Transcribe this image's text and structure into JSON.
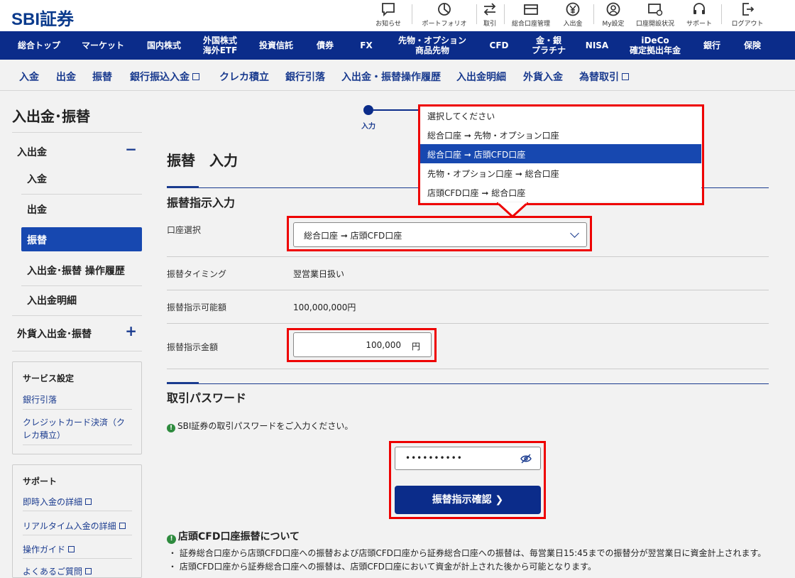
{
  "brand": {
    "logo": "SBI証券"
  },
  "utility": [
    {
      "label": "お知らせ",
      "icon": "message-icon"
    },
    {
      "label": "ポートフォリオ",
      "icon": "pie-chart-icon"
    },
    {
      "label": "取引",
      "icon": "arrows-icon"
    },
    {
      "label": "総合口座管理",
      "icon": "card-icon"
    },
    {
      "label": "入出金",
      "icon": "yen-icon"
    },
    {
      "label": "My設定",
      "icon": "user-icon"
    },
    {
      "label": "口座開設状況",
      "icon": "account-status-icon"
    },
    {
      "label": "サポート",
      "icon": "headset-icon"
    },
    {
      "label": "ログアウト",
      "icon": "logout-icon"
    }
  ],
  "global_nav": [
    {
      "label": "総合トップ"
    },
    {
      "label": "マーケット"
    },
    {
      "label": "国内株式"
    },
    {
      "label": "外国株式\n海外ETF"
    },
    {
      "label": "投資信託"
    },
    {
      "label": "債券"
    },
    {
      "label": "FX"
    },
    {
      "label": "先物・オプション\n商品先物"
    },
    {
      "label": "CFD"
    },
    {
      "label": "金・銀\nプラチナ"
    },
    {
      "label": "NISA"
    },
    {
      "label": "iDeCo\n確定拠出年金"
    },
    {
      "label": "銀行"
    },
    {
      "label": "保険"
    }
  ],
  "sub_nav": [
    {
      "label": "入金"
    },
    {
      "label": "出金"
    },
    {
      "label": "振替"
    },
    {
      "label": "銀行振込入金"
    },
    {
      "label": "クレカ積立"
    },
    {
      "label": "銀行引落"
    },
    {
      "label": "入出金・振替操作履歴"
    },
    {
      "label": "入出金明細"
    },
    {
      "label": "外貨入金"
    },
    {
      "label": "為替取引"
    }
  ],
  "sidebar": {
    "title": "入出金･振替",
    "group1": "入出金",
    "group1_toggle": "−",
    "items": [
      "入金",
      "出金",
      "振替",
      "入出金･振替 操作履歴",
      "入出金明細"
    ],
    "group2": "外貨入出金･振替",
    "group2_toggle": "+",
    "service": {
      "title": "サービス設定",
      "links": [
        "銀行引落",
        "クレジットカード決済（ク\nレカ積立）"
      ]
    },
    "support": {
      "title": "サポート",
      "links": [
        "即時入金の詳細",
        "リアルタイム入金の詳細",
        "操作ガイド",
        "よくあるご質問"
      ]
    }
  },
  "stepper": {
    "current": "入力"
  },
  "page": {
    "title": "振替　入力"
  },
  "transfer": {
    "section_title": "振替指示入力",
    "account_label": "口座選択",
    "account_value": "総合口座 ➞ 店頭CFD口座",
    "dropdown": [
      {
        "label": "選択してください",
        "selected": false
      },
      {
        "label": "総合口座 ➞ 先物・オプション口座",
        "selected": false
      },
      {
        "label": "総合口座 ➞ 店頭CFD口座",
        "selected": true
      },
      {
        "label": "先物・オプション口座 ➞ 総合口座",
        "selected": false
      },
      {
        "label": "店頭CFD口座 ➞ 総合口座",
        "selected": false
      }
    ],
    "timing_label": "振替タイミング",
    "timing_value": "翌営業日扱い",
    "available_label": "振替指示可能額",
    "available_value": "100,000,000円",
    "amount_label": "振替指示金額",
    "amount_value": "100,000",
    "amount_unit": "円"
  },
  "password": {
    "section_title": "取引パスワード",
    "note": "SBI証券の取引パスワードをご入力ください。",
    "value": "••••••••••",
    "confirm_label": "振替指示確認 ❯"
  },
  "info": {
    "title": "店頭CFD口座振替について",
    "bullets": [
      "・ 証券総合口座から店頭CFD口座への振替および店頭CFD口座から証券総合口座への振替は、毎営業日15:45までの振替分が翌営業日に資金計上されます。",
      "・ 店頭CFD口座から証券総合口座への振替は、店頭CFD口座において資金が計上された後から可能となります。"
    ]
  },
  "colors": {
    "navy": "#0b2c8a",
    "accent": "#1748b0",
    "highlight": "#e00000",
    "info_green": "#2e8b3e"
  }
}
